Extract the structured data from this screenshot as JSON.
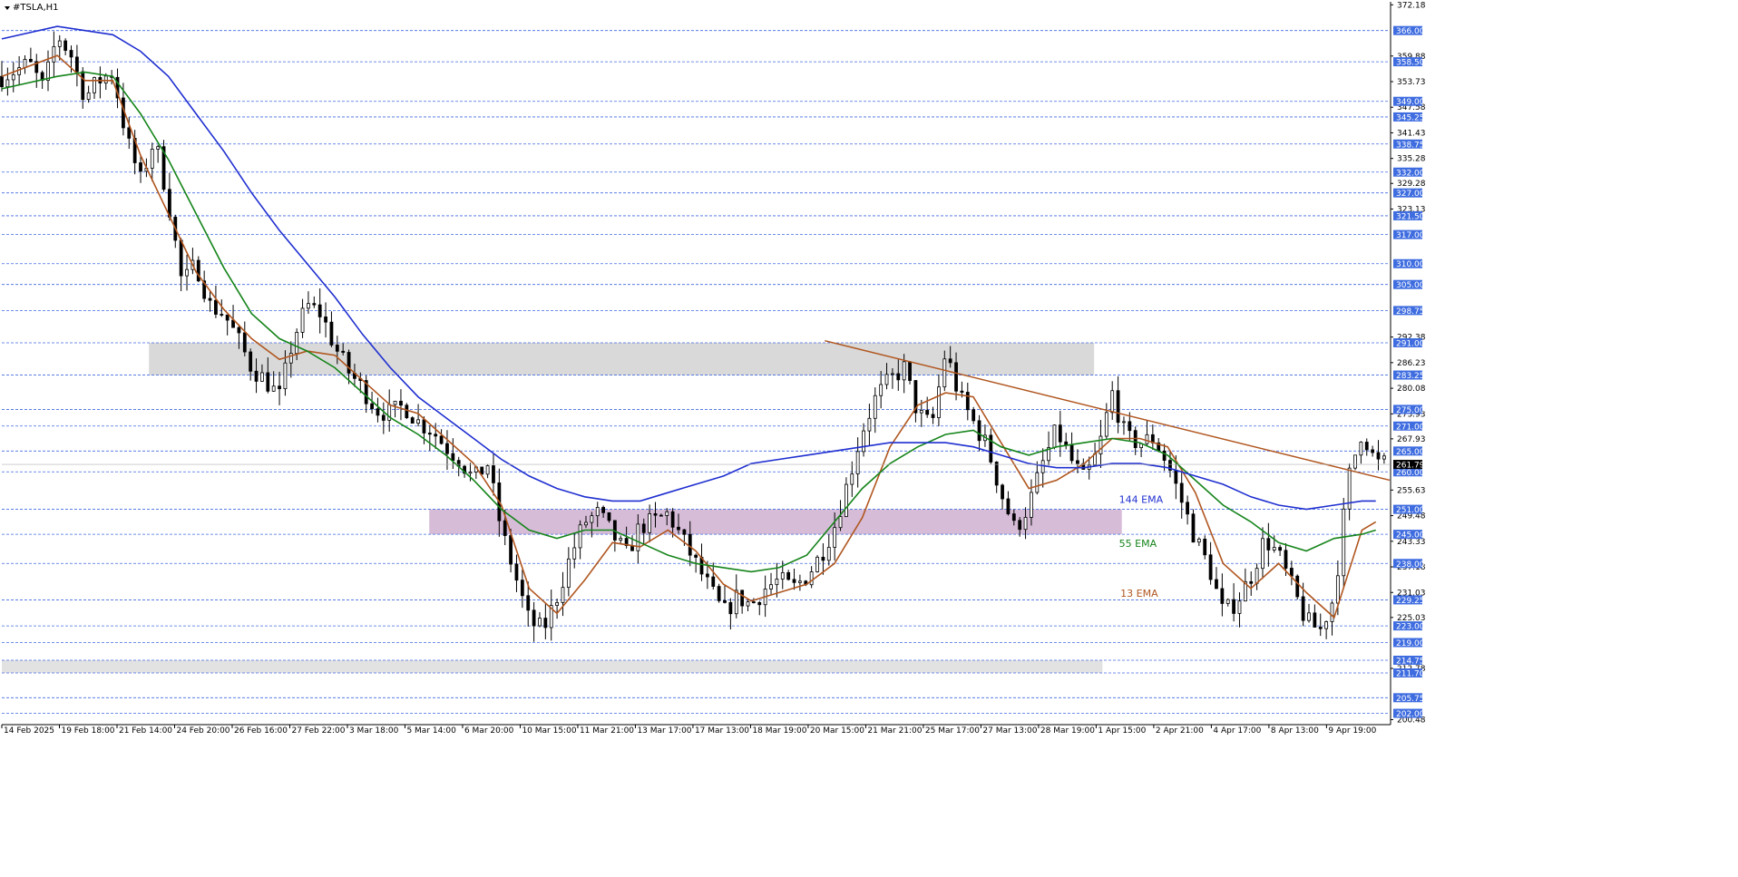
{
  "window": {
    "title": "#TSLA,H1",
    "menu_icon": "triangle-down-icon"
  },
  "current_price": "261.79",
  "colors": {
    "background": "#ffffff",
    "bull_candle": "#000000",
    "bear_candle": "#000000",
    "level_line": "#4169e1",
    "level_tag_bg": "#3f6de0",
    "ema13": "#b0561f",
    "ema55": "#15841a",
    "ema144": "#1f2fd0",
    "trendline": "#b0561f",
    "resistance_zone": "#d9d9d9",
    "support_zone": "#d6bcd7",
    "bottom_zone": "#e2e2e2"
  },
  "chart_data": {
    "type": "candlestick",
    "symbol": "#TSLA,H1",
    "timeframe": "H1",
    "ylim": [
      199.5,
      372.9
    ],
    "x_range": [
      0,
      100
    ],
    "y_axis_ticks": [
      "372.18",
      "366.00",
      "359.88",
      "358.50",
      "353.73",
      "349.00",
      "347.58",
      "345.25",
      "341.43",
      "338.75",
      "335.28",
      "332.00",
      "329.28",
      "327.00",
      "323.13",
      "321.50",
      "317.00",
      "310.00",
      "305.00",
      "298.75",
      "292.38",
      "291.00",
      "286.23",
      "283.25",
      "280.08",
      "275.00",
      "273.93",
      "271.00",
      "267.93",
      "265.00",
      "261.79",
      "260.00",
      "255.63",
      "251.00",
      "249.48",
      "245.00",
      "243.33",
      "238.00",
      "237.18",
      "231.03",
      "229.25",
      "225.03",
      "223.00",
      "219.00",
      "214.75",
      "212.78",
      "211.70",
      "205.75",
      "202.00",
      "200.48"
    ],
    "horizontal_levels": [
      366.0,
      358.5,
      349.0,
      345.25,
      338.75,
      332.0,
      327.0,
      321.5,
      317.0,
      310.0,
      305.0,
      298.75,
      291.0,
      283.25,
      275.0,
      271.0,
      265.0,
      260.0,
      251.0,
      245.0,
      238.0,
      229.25,
      223.0,
      219.0,
      214.75,
      211.7,
      205.75,
      202.0
    ],
    "level_labels": [
      "366.00",
      "358.50",
      "349.00",
      "345.25",
      "338.75",
      "332.00",
      "327.00",
      "321.50",
      "317.00",
      "310.00",
      "305.00",
      "298.75",
      "291.00",
      "283.25",
      "275.00",
      "271.00",
      "265.00",
      "260.00",
      "251.00",
      "245.00",
      "238.00",
      "229.25",
      "223.00",
      "219.00",
      "214.75",
      "211.70",
      "205.75",
      "202.00"
    ],
    "x_axis_labels": [
      "14 Feb 2025",
      "19 Feb 18:00",
      "21 Feb 14:00",
      "24 Feb 20:00",
      "26 Feb 16:00",
      "27 Feb 22:00",
      "3 Mar 18:00",
      "5 Mar 14:00",
      "6 Mar 20:00",
      "10 Mar 15:00",
      "11 Mar 21:00",
      "13 Mar 17:00",
      "17 Mar 13:00",
      "18 Mar 19:00",
      "20 Mar 15:00",
      "21 Mar 21:00",
      "25 Mar 17:00",
      "27 Mar 13:00",
      "28 Mar 19:00",
      "1 Apr 15:00",
      "2 Apr 21:00",
      "4 Apr 17:00",
      "8 Apr 13:00",
      "9 Apr 19:00"
    ],
    "x_axis_positions": [
      0.0,
      4.15,
      8.3,
      12.45,
      16.6,
      20.75,
      24.9,
      29.05,
      33.2,
      37.35,
      41.5,
      45.65,
      49.8,
      53.95,
      58.1,
      62.25,
      66.4,
      70.55,
      74.7,
      78.85,
      83.0,
      87.15,
      91.3,
      95.45
    ],
    "price_path": [
      [
        0,
        355
      ],
      [
        2,
        358
      ],
      [
        3,
        352
      ],
      [
        4,
        365
      ],
      [
        5,
        360
      ],
      [
        6,
        350
      ],
      [
        7,
        354
      ],
      [
        8,
        356
      ],
      [
        9,
        340
      ],
      [
        10,
        330
      ],
      [
        11,
        340
      ],
      [
        12,
        325
      ],
      [
        13,
        305
      ],
      [
        14,
        310
      ],
      [
        15,
        300
      ],
      [
        16,
        298
      ],
      [
        17,
        292
      ],
      [
        18,
        285
      ],
      [
        19,
        282
      ],
      [
        20,
        278
      ],
      [
        21,
        292
      ],
      [
        22,
        300
      ],
      [
        23,
        298
      ],
      [
        24,
        290
      ],
      [
        25,
        284
      ],
      [
        26,
        280
      ],
      [
        27,
        275
      ],
      [
        28,
        274
      ],
      [
        29,
        276
      ],
      [
        30,
        272
      ],
      [
        31,
        270
      ],
      [
        32,
        266
      ],
      [
        33,
        263
      ],
      [
        34,
        258
      ],
      [
        35,
        262
      ],
      [
        36,
        246
      ],
      [
        37,
        235
      ],
      [
        38,
        224
      ],
      [
        39,
        222
      ],
      [
        40,
        230
      ],
      [
        41,
        240
      ],
      [
        42,
        248
      ],
      [
        43,
        250
      ],
      [
        44,
        245
      ],
      [
        45,
        240
      ],
      [
        46,
        247
      ],
      [
        47,
        248
      ],
      [
        48,
        250
      ],
      [
        49,
        244
      ],
      [
        50,
        238
      ],
      [
        51,
        232
      ],
      [
        52,
        226
      ],
      [
        53,
        230
      ],
      [
        54,
        228
      ],
      [
        55,
        232
      ],
      [
        56,
        234
      ],
      [
        57,
        232
      ],
      [
        58,
        235
      ],
      [
        59,
        240
      ],
      [
        60,
        247
      ],
      [
        61,
        258
      ],
      [
        62,
        270
      ],
      [
        63,
        278
      ],
      [
        64,
        282
      ],
      [
        65,
        285
      ],
      [
        66,
        274
      ],
      [
        67,
        271
      ],
      [
        68,
        289
      ],
      [
        69,
        278
      ],
      [
        70,
        272
      ],
      [
        71,
        266
      ],
      [
        72,
        255
      ],
      [
        73,
        246
      ],
      [
        74,
        252
      ],
      [
        75,
        262
      ],
      [
        76,
        270
      ],
      [
        77,
        263
      ],
      [
        78,
        258
      ],
      [
        79,
        265
      ],
      [
        80,
        279
      ],
      [
        81,
        268
      ],
      [
        82,
        267
      ],
      [
        83,
        268
      ],
      [
        84,
        262
      ],
      [
        85,
        253
      ],
      [
        86,
        244
      ],
      [
        87,
        237
      ],
      [
        88,
        226
      ],
      [
        89,
        229
      ],
      [
        90,
        235
      ],
      [
        91,
        244
      ],
      [
        92,
        240
      ],
      [
        93,
        232
      ],
      [
        94,
        224
      ],
      [
        95,
        222
      ],
      [
        96,
        230
      ],
      [
        97,
        258
      ],
      [
        98,
        270
      ],
      [
        99,
        262
      ]
    ],
    "indicators": [
      {
        "name": "13 EMA",
        "color": "#b0561f",
        "values": [
          [
            0,
            355
          ],
          [
            4,
            360
          ],
          [
            6,
            354
          ],
          [
            8,
            354
          ],
          [
            10,
            336
          ],
          [
            12,
            322
          ],
          [
            14,
            308
          ],
          [
            16,
            299
          ],
          [
            18,
            292
          ],
          [
            20,
            287
          ],
          [
            22,
            289
          ],
          [
            24,
            288
          ],
          [
            26,
            282
          ],
          [
            28,
            276
          ],
          [
            30,
            274
          ],
          [
            32,
            268
          ],
          [
            34,
            262
          ],
          [
            36,
            252
          ],
          [
            38,
            232
          ],
          [
            40,
            226
          ],
          [
            42,
            234
          ],
          [
            44,
            243
          ],
          [
            46,
            242
          ],
          [
            48,
            246
          ],
          [
            50,
            241
          ],
          [
            52,
            233
          ],
          [
            54,
            229
          ],
          [
            56,
            231
          ],
          [
            58,
            233
          ],
          [
            60,
            238
          ],
          [
            62,
            249
          ],
          [
            64,
            266
          ],
          [
            66,
            276
          ],
          [
            68,
            279
          ],
          [
            70,
            278
          ],
          [
            72,
            267
          ],
          [
            74,
            256
          ],
          [
            76,
            258
          ],
          [
            78,
            262
          ],
          [
            80,
            268
          ],
          [
            82,
            268
          ],
          [
            84,
            266
          ],
          [
            86,
            255
          ],
          [
            88,
            238
          ],
          [
            90,
            232
          ],
          [
            92,
            238
          ],
          [
            94,
            231
          ],
          [
            96,
            225
          ],
          [
            98,
            246
          ],
          [
            99,
            248
          ]
        ]
      },
      {
        "name": "55 EMA",
        "color": "#15841a",
        "values": [
          [
            0,
            352
          ],
          [
            4,
            355
          ],
          [
            6,
            356
          ],
          [
            8,
            355
          ],
          [
            10,
            346
          ],
          [
            12,
            335
          ],
          [
            14,
            322
          ],
          [
            16,
            309
          ],
          [
            18,
            298
          ],
          [
            20,
            292
          ],
          [
            22,
            289
          ],
          [
            24,
            285
          ],
          [
            26,
            279
          ],
          [
            28,
            273
          ],
          [
            30,
            269
          ],
          [
            32,
            264
          ],
          [
            34,
            258
          ],
          [
            36,
            251
          ],
          [
            38,
            246
          ],
          [
            40,
            244
          ],
          [
            42,
            246
          ],
          [
            44,
            246
          ],
          [
            46,
            243
          ],
          [
            48,
            240
          ],
          [
            50,
            238
          ],
          [
            52,
            237
          ],
          [
            54,
            236
          ],
          [
            56,
            237
          ],
          [
            58,
            240
          ],
          [
            60,
            248
          ],
          [
            62,
            256
          ],
          [
            64,
            262
          ],
          [
            66,
            266
          ],
          [
            68,
            269
          ],
          [
            70,
            270
          ],
          [
            72,
            266
          ],
          [
            74,
            264
          ],
          [
            76,
            266
          ],
          [
            78,
            267
          ],
          [
            80,
            268
          ],
          [
            82,
            267
          ],
          [
            84,
            264
          ],
          [
            86,
            258
          ],
          [
            88,
            252
          ],
          [
            90,
            248
          ],
          [
            92,
            243
          ],
          [
            94,
            241
          ],
          [
            96,
            244
          ],
          [
            98,
            245
          ],
          [
            99,
            246
          ]
        ]
      },
      {
        "name": "144 EMA",
        "color": "#1f2fd0",
        "values": [
          [
            0,
            364
          ],
          [
            4,
            367
          ],
          [
            8,
            365
          ],
          [
            10,
            361
          ],
          [
            12,
            355
          ],
          [
            14,
            346
          ],
          [
            16,
            337
          ],
          [
            18,
            327
          ],
          [
            20,
            318
          ],
          [
            22,
            310
          ],
          [
            24,
            302
          ],
          [
            26,
            293
          ],
          [
            28,
            285
          ],
          [
            30,
            278
          ],
          [
            32,
            273
          ],
          [
            34,
            268
          ],
          [
            36,
            263
          ],
          [
            38,
            259
          ],
          [
            40,
            256
          ],
          [
            42,
            254
          ],
          [
            44,
            253
          ],
          [
            46,
            253
          ],
          [
            48,
            255
          ],
          [
            50,
            257
          ],
          [
            52,
            259
          ],
          [
            54,
            262
          ],
          [
            56,
            263
          ],
          [
            58,
            264
          ],
          [
            60,
            265
          ],
          [
            62,
            266
          ],
          [
            64,
            267
          ],
          [
            66,
            267
          ],
          [
            68,
            267
          ],
          [
            70,
            266
          ],
          [
            72,
            264
          ],
          [
            74,
            262
          ],
          [
            76,
            261
          ],
          [
            78,
            261
          ],
          [
            80,
            262
          ],
          [
            82,
            262
          ],
          [
            84,
            261
          ],
          [
            86,
            259
          ],
          [
            88,
            257
          ],
          [
            90,
            254
          ],
          [
            92,
            252
          ],
          [
            94,
            251
          ],
          [
            96,
            252
          ],
          [
            98,
            253
          ],
          [
            99,
            253
          ]
        ]
      }
    ],
    "ema_labels": [
      "144 EMA",
      "55 EMA",
      "13 EMA"
    ],
    "trendline": {
      "from": [
        59.3,
        291.5
      ],
      "to": [
        100,
        258.0
      ]
    },
    "zones": [
      {
        "type": "resistance",
        "x_from": 10.6,
        "x_to": 78.7,
        "y_from": 283.2,
        "y_to": 291.0
      },
      {
        "type": "support",
        "x_from": 30.8,
        "x_to": 80.7,
        "y_from": 245.0,
        "y_to": 251.0
      },
      {
        "type": "support",
        "x_from": 0,
        "x_to": 79.3,
        "y_from": 211.7,
        "y_to": 214.75
      }
    ],
    "grid": false,
    "legend": "none"
  }
}
